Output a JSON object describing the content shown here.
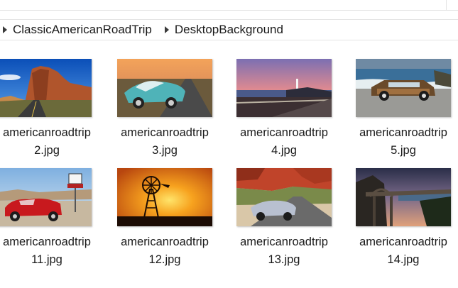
{
  "breadcrumb": {
    "items": [
      "ClassicAmericanRoadTrip",
      "DesktopBackground"
    ]
  },
  "files": [
    {
      "name_line1": "americanroadtrip",
      "name_line2": "2.jpg",
      "image": "desert-rock-arch-road"
    },
    {
      "name_line1": "americanroadtrip",
      "name_line2": "3.jpg",
      "image": "teal-corvette-on-road"
    },
    {
      "name_line1": "americanroadtrip",
      "name_line2": "4.jpg",
      "image": "lighthouse-coast-sunset"
    },
    {
      "name_line1": "americanroadtrip",
      "name_line2": "5.jpg",
      "image": "woody-wagon-ocean"
    },
    {
      "name_line1": "americanroadtrip",
      "name_line2": "11.jpg",
      "image": "red-cobra-route66"
    },
    {
      "name_line1": "americanroadtrip",
      "name_line2": "12.jpg",
      "image": "windmill-orange-sunset"
    },
    {
      "name_line1": "americanroadtrip",
      "name_line2": "13.jpg",
      "image": "silver-convertible-red-canyon"
    },
    {
      "name_line1": "americanroadtrip",
      "name_line2": "14.jpg",
      "image": "bixby-bridge-dusk"
    }
  ]
}
